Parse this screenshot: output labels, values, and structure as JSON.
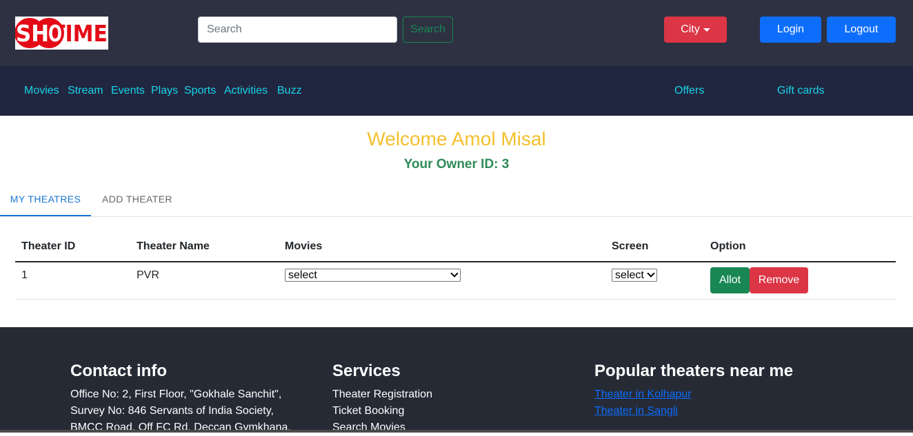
{
  "header": {
    "logo_text": "SHOWTIME",
    "search": {
      "placeholder": "Search",
      "value": ""
    },
    "search_button": "Search",
    "city_button": "City",
    "login_button": "Login",
    "logout_button": "Logout"
  },
  "nav": {
    "items": [
      "Movies",
      "Stream",
      "Events",
      "Plays",
      "Sports",
      "Activities",
      "Buzz"
    ],
    "offers": "Offers",
    "gift_cards": "Gift cards"
  },
  "welcome": {
    "title": "Welcome Amol Misal",
    "owner_id_label": "Your Owner ID:",
    "owner_id": "3"
  },
  "tabs": [
    "MY THEATRES",
    "ADD THEATER"
  ],
  "table": {
    "headers": [
      "Theater ID",
      "Theater Name",
      "Movies",
      "Screen",
      "Option"
    ],
    "rows": [
      {
        "theater_id": "1",
        "theater_name": "PVR",
        "movies_select": "select",
        "screen_select": "select",
        "allot": "Allot",
        "remove": "Remove"
      }
    ]
  },
  "footer": {
    "contact": {
      "heading": "Contact info",
      "lines": [
        "Office No: 2, First Floor, \"Gokhale Sanchit\",",
        "Survey No: 846 Servants of India Society,",
        "BMCC Road, Off FC Rd, Deccan Gymkhana,"
      ]
    },
    "services": {
      "heading": "Services",
      "items": [
        "Theater Registration",
        "Ticket Booking",
        "Search Movies"
      ]
    },
    "popular": {
      "heading": "Popular theaters near me",
      "links": [
        "Theater in Kolhapur",
        "Theater in Sangli"
      ]
    }
  },
  "colors": {
    "topbar": "#2e3142",
    "navbar": "#212640",
    "nav_link": "#18d4e8",
    "welcome": "#f4c02d",
    "owner_id": "#2e8b57",
    "primary": "#0d6efd",
    "danger": "#dc3545",
    "success": "#198754",
    "footer": "#262a35"
  }
}
